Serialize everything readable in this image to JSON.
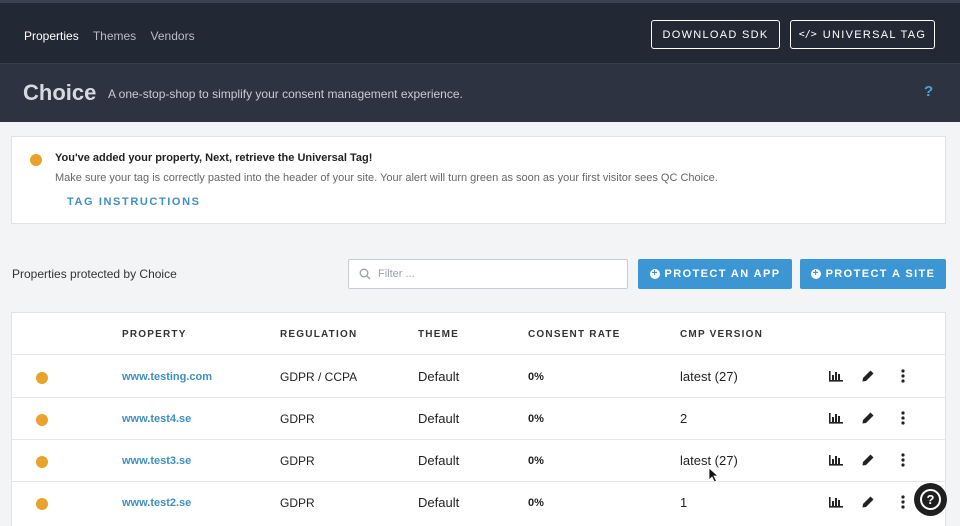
{
  "nav": {
    "items": [
      {
        "label": "Properties",
        "active": true
      },
      {
        "label": "Themes",
        "active": false
      },
      {
        "label": "Vendors",
        "active": false
      }
    ],
    "download_sdk": "DOWNLOAD SDK",
    "universal_tag_icon": "</>",
    "universal_tag": "UNIVERSAL TAG"
  },
  "hero": {
    "title": "Choice",
    "subtitle": "A one-stop-shop to simplify your consent management experience.",
    "help": "?"
  },
  "alert": {
    "title": "You've added your property, Next, retrieve the Universal Tag!",
    "body": "Make sure your tag is correctly pasted into the header of your site. Your alert will turn green as soon as your first visitor sees QC Choice.",
    "link": "TAG INSTRUCTIONS",
    "status_color": "#e9a22b"
  },
  "toolbar": {
    "label": "Properties protected by Choice",
    "filter_placeholder": "Filter ...",
    "protect_app": "PROTECT AN APP",
    "protect_site": "PROTECT A SITE",
    "accent_color": "#3c96d3"
  },
  "table": {
    "headers": [
      "PROPERTY",
      "REGULATION",
      "THEME",
      "CONSENT RATE",
      "CMP VERSION"
    ],
    "rows": [
      {
        "property": "www.testing.com",
        "regulation": "GDPR / CCPA",
        "theme": "Default",
        "consent_rate": "0%",
        "cmp_version": "latest (27)"
      },
      {
        "property": "www.test4.se",
        "regulation": "GDPR",
        "theme": "Default",
        "consent_rate": "0%",
        "cmp_version": "2"
      },
      {
        "property": "www.test3.se",
        "regulation": "GDPR",
        "theme": "Default",
        "consent_rate": "0%",
        "cmp_version": "latest (27)"
      },
      {
        "property": "www.test2.se",
        "regulation": "GDPR",
        "theme": "Default",
        "consent_rate": "0%",
        "cmp_version": "1"
      }
    ],
    "row_icons": [
      "bar-chart-icon",
      "pencil-icon",
      "kebab-menu-icon"
    ]
  },
  "help_fab": {
    "label": "?"
  }
}
